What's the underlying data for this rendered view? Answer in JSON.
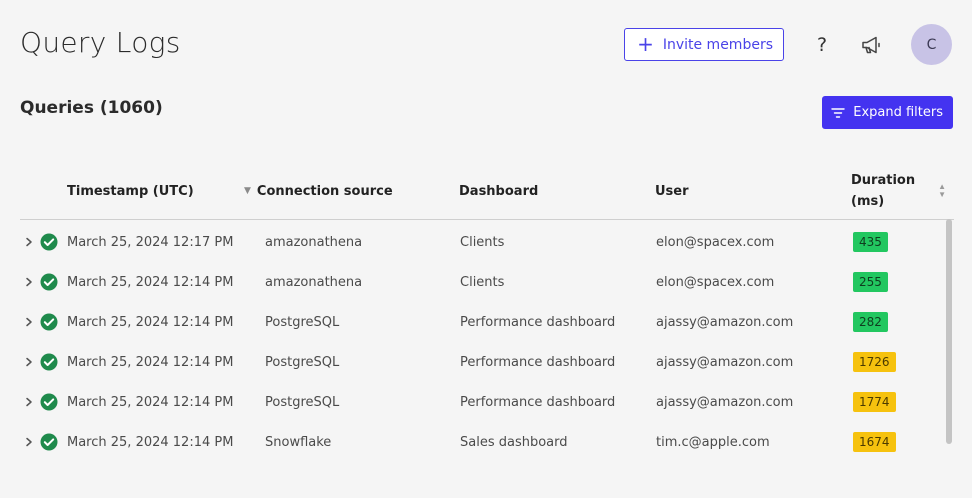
{
  "page": {
    "title": "Query Logs"
  },
  "header": {
    "invite_label": "Invite members",
    "help_label": "?",
    "avatar_initial": "C"
  },
  "queries": {
    "heading": "Queries (1060)",
    "expand_filters_label": "Expand filters"
  },
  "table": {
    "columns": {
      "timestamp": "Timestamp (UTC)",
      "source": "Connection source",
      "dashboard": "Dashboard",
      "user": "User",
      "duration_line1": "Duration",
      "duration_line2": "(ms)"
    },
    "rows": [
      {
        "timestamp": "March 25, 2024 12:17 PM",
        "source": "amazonathena",
        "dashboard": "Clients",
        "user": "elon@spacex.com",
        "duration": "435",
        "status": "green"
      },
      {
        "timestamp": "March 25, 2024 12:14 PM",
        "source": "amazonathena",
        "dashboard": "Clients",
        "user": "elon@spacex.com",
        "duration": "255",
        "status": "green"
      },
      {
        "timestamp": "March 25, 2024 12:14 PM",
        "source": "PostgreSQL",
        "dashboard": "Performance dashboard",
        "user": "ajassy@amazon.com",
        "duration": "282",
        "status": "green"
      },
      {
        "timestamp": "March 25, 2024 12:14 PM",
        "source": "PostgreSQL",
        "dashboard": "Performance dashboard",
        "user": "ajassy@amazon.com",
        "duration": "1726",
        "status": "yellow"
      },
      {
        "timestamp": "March 25, 2024 12:14 PM",
        "source": "PostgreSQL",
        "dashboard": "Performance dashboard",
        "user": "ajassy@amazon.com",
        "duration": "1774",
        "status": "yellow"
      },
      {
        "timestamp": "March 25, 2024 12:14 PM",
        "source": "Snowflake",
        "dashboard": "Sales dashboard",
        "user": "tim.c@apple.com",
        "duration": "1674",
        "status": "yellow"
      }
    ]
  },
  "colors": {
    "accent": "#4433f0",
    "success": "#22c760",
    "warning": "#f6c20e",
    "check": "#1f8a4c"
  },
  "icons": {
    "invite": "plus-icon",
    "help": "question-icon",
    "announce": "megaphone-icon",
    "filter": "filter-icon",
    "row_expand": "chevron-right-icon",
    "row_status": "check-circle-icon",
    "sort": "sort-icon"
  }
}
